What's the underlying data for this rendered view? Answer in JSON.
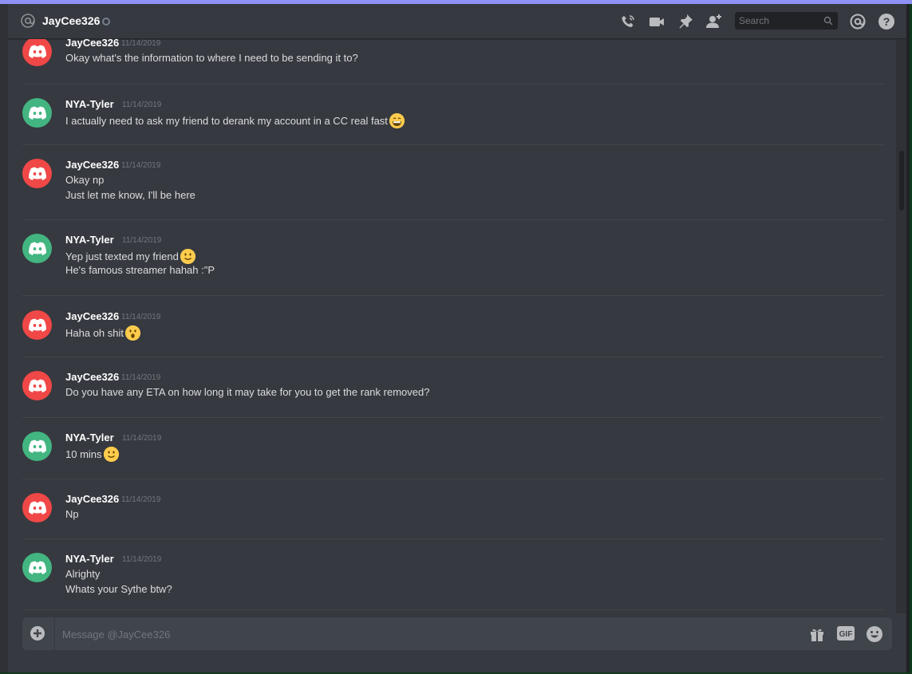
{
  "header": {
    "channel_name": "JayCee326",
    "search_placeholder": "Search"
  },
  "messages": [
    {
      "author": "JayCee326",
      "avatar_color": "#f04747",
      "timestamp": "11/14/2019",
      "lines": [
        "Okay what's the information to where I need to be sending it to?"
      ]
    },
    {
      "author": "NYA-Tyler",
      "avatar_color": "#43b581",
      "timestamp": "11/14/2019",
      "lines": [
        "I actually need to ask my friend to derank my account in a CC real fast"
      ],
      "emoji": "grin-icon"
    },
    {
      "author": "JayCee326",
      "avatar_color": "#f04747",
      "timestamp": "11/14/2019",
      "lines": [
        "Okay np",
        "Just let me know, I'll be here"
      ]
    },
    {
      "author": "NYA-Tyler",
      "avatar_color": "#43b581",
      "timestamp": "11/14/2019",
      "lines": [
        "Yep just texted my friend",
        "He's famous streamer hahah :\"P"
      ],
      "emoji": "slight-smile-icon"
    },
    {
      "author": "JayCee326",
      "avatar_color": "#f04747",
      "timestamp": "11/14/2019",
      "lines": [
        "Haha oh shit"
      ],
      "emoji": "open-mouth-icon"
    },
    {
      "author": "JayCee326",
      "avatar_color": "#f04747",
      "timestamp": "11/14/2019",
      "lines": [
        "Do you have any ETA on how long it may take for you to get the rank removed?"
      ]
    },
    {
      "author": "NYA-Tyler",
      "avatar_color": "#43b581",
      "timestamp": "11/14/2019",
      "lines": [
        "10 mins"
      ],
      "emoji": "slight-smile-icon"
    },
    {
      "author": "JayCee326",
      "avatar_color": "#f04747",
      "timestamp": "11/14/2019",
      "lines": [
        "Np"
      ]
    },
    {
      "author": "NYA-Tyler",
      "avatar_color": "#43b581",
      "timestamp": "11/14/2019",
      "lines": [
        "Alrighty",
        "Whats your Sythe btw?"
      ]
    }
  ],
  "composer": {
    "placeholder": "Message @JayCee326",
    "gif_label": "GIF"
  },
  "colors": {
    "background": "#36393f",
    "online_red": "#f04747",
    "online_green": "#43b581"
  }
}
